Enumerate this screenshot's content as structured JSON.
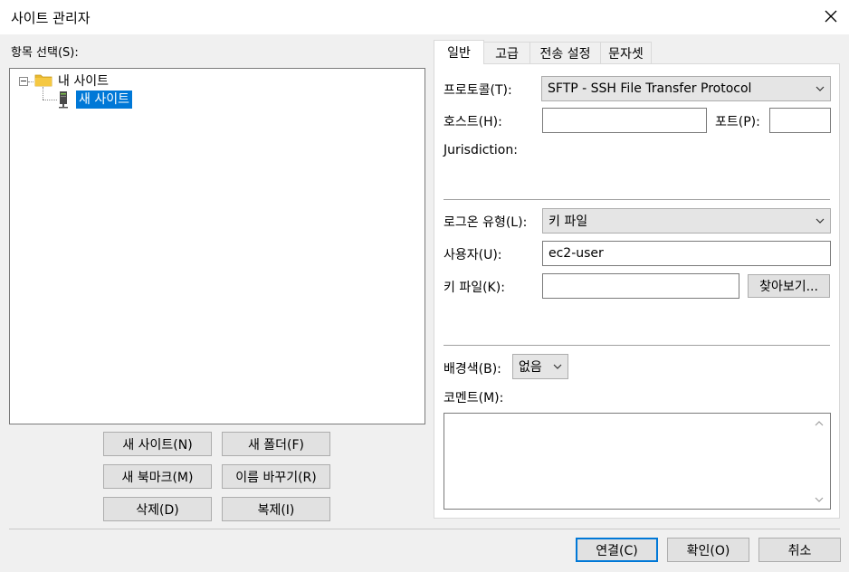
{
  "window": {
    "title": "사이트 관리자",
    "close_icon": "close-icon"
  },
  "left": {
    "items_label": "항목 선택(S):",
    "tree": {
      "root_label": "내 사이트",
      "child_label": "새 사이트"
    },
    "buttons": {
      "new_site": "새 사이트(N)",
      "new_folder": "새 폴더(F)",
      "new_bookmark": "새 북마크(M)",
      "rename": "이름 바꾸기(R)",
      "delete": "삭제(D)",
      "duplicate": "복제(I)"
    }
  },
  "tabs": [
    "일반",
    "고급",
    "전송 설정",
    "문자셋"
  ],
  "general": {
    "protocol_label": "프로토콜(T):",
    "protocol_value": "SFTP - SSH File Transfer Protocol",
    "host_label": "호스트(H):",
    "host_value": "",
    "port_label": "포트(P):",
    "port_value": "",
    "jurisdiction_label": "Jurisdiction:",
    "logon_type_label": "로그온 유형(L):",
    "logon_type_value": "키 파일",
    "user_label": "사용자(U):",
    "user_value": "ec2-user",
    "keyfile_label": "키 파일(K):",
    "keyfile_value": "",
    "browse_label": "찾아보기...",
    "bgcolor_label": "배경색(B):",
    "bgcolor_value": "없음",
    "comment_label": "코멘트(M):",
    "comment_value": ""
  },
  "footer": {
    "connect": "연결(C)",
    "ok": "확인(O)",
    "cancel": "취소"
  },
  "colors": {
    "selection": "#0078d7",
    "folder": "#e8b830",
    "button_bg": "#e1e1e1",
    "dialog_bg": "#f0f0f0"
  }
}
